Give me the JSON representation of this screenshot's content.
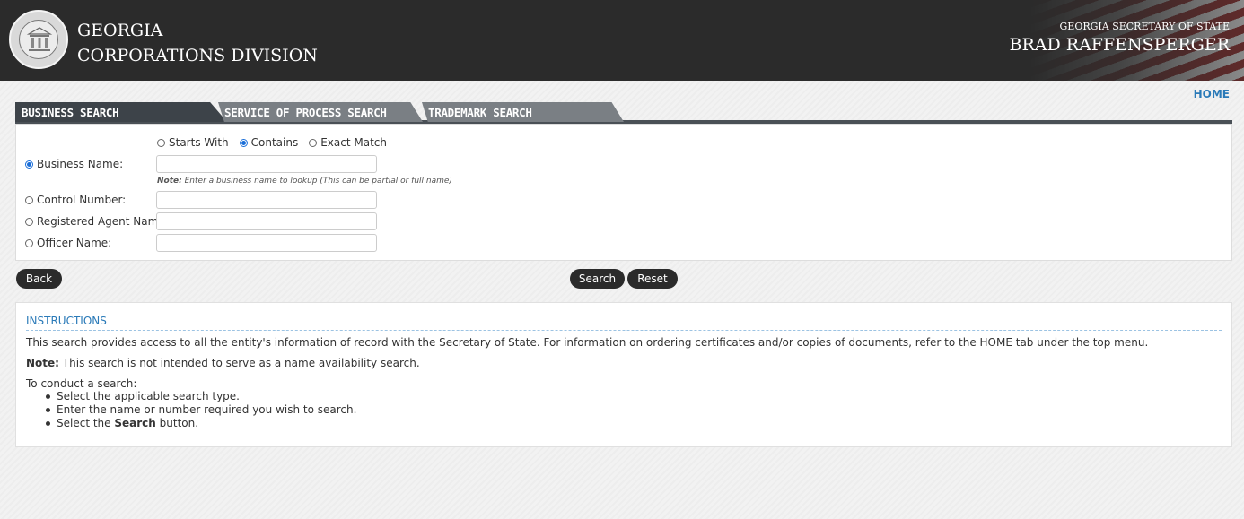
{
  "header": {
    "title_line1": "GEORGIA",
    "title_line2": "CORPORATIONS DIVISION",
    "right_small": "GEORGIA SECRETARY OF STATE",
    "right_big": "BRAD RAFFENSPERGER"
  },
  "nav": {
    "home": "HOME"
  },
  "tabs": [
    {
      "label": "BUSINESS SEARCH",
      "active": true
    },
    {
      "label": "SERVICE OF PROCESS SEARCH",
      "active": false
    },
    {
      "label": "TRADEMARK SEARCH",
      "active": false
    }
  ],
  "form": {
    "match_options": [
      {
        "label": "Starts With",
        "selected": false
      },
      {
        "label": "Contains",
        "selected": true
      },
      {
        "label": "Exact Match",
        "selected": false
      }
    ],
    "business_name_label": "Business Name:",
    "business_name_value": "",
    "note_bold": "Note:",
    "note_text": "Enter a business name to lookup (This can be partial or full name)",
    "control_number_label": "Control Number:",
    "registered_agent_label": "Registered Agent Name:",
    "officer_name_label": "Officer Name:"
  },
  "buttons": {
    "back": "Back",
    "search": "Search",
    "reset": "Reset"
  },
  "instructions": {
    "title": "INSTRUCTIONS",
    "para1": "This search provides access to all the entity's information of record with the Secretary of State. For information on ordering certificates and/or copies of documents, refer to the HOME tab under the top menu.",
    "note_bold": "Note:",
    "note_text": "This search is not intended to serve as a name availability search.",
    "conduct": "To conduct a search:",
    "step1": "Select the applicable search type.",
    "step2": "Enter the name or number required you wish to search.",
    "step3_pre": "Select the",
    "step3_bold": "Search",
    "step3_post": "button."
  },
  "colors": {
    "header_bg": "#2b2b2b",
    "accent_link": "#2a7ab8",
    "tab_active": "#3d4349",
    "tab_inactive": "#7a7f84"
  },
  "icons": {
    "seal": "georgia-state-seal-icon"
  }
}
